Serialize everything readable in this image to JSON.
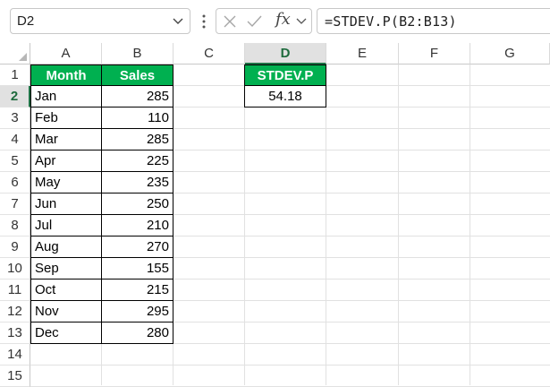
{
  "formula_bar": {
    "name_box": "D2",
    "fx_label": "fx",
    "formula": "=STDEV.P(B2:B13)"
  },
  "columns": [
    "A",
    "B",
    "C",
    "D",
    "E",
    "F",
    "G"
  ],
  "rows": [
    "1",
    "2",
    "3",
    "4",
    "5",
    "6",
    "7",
    "8",
    "9",
    "10",
    "11",
    "12",
    "13",
    "14",
    "15"
  ],
  "selected": {
    "column": "D",
    "row": "2"
  },
  "table": {
    "headers": [
      "Month",
      "Sales"
    ],
    "rows": [
      [
        "Jan",
        "285"
      ],
      [
        "Feb",
        "110"
      ],
      [
        "Mar",
        "285"
      ],
      [
        "Apr",
        "225"
      ],
      [
        "May",
        "235"
      ],
      [
        "Jun",
        "250"
      ],
      [
        "Jul",
        "210"
      ],
      [
        "Aug",
        "270"
      ],
      [
        "Sep",
        "155"
      ],
      [
        "Oct",
        "215"
      ],
      [
        "Nov",
        "295"
      ],
      [
        "Dec",
        "280"
      ]
    ]
  },
  "result": {
    "header": "STDEV.P",
    "value": "54.18"
  },
  "colors": {
    "header_fill": "#00b050",
    "header_text": "#ffffff",
    "selection": "#1e7145"
  }
}
